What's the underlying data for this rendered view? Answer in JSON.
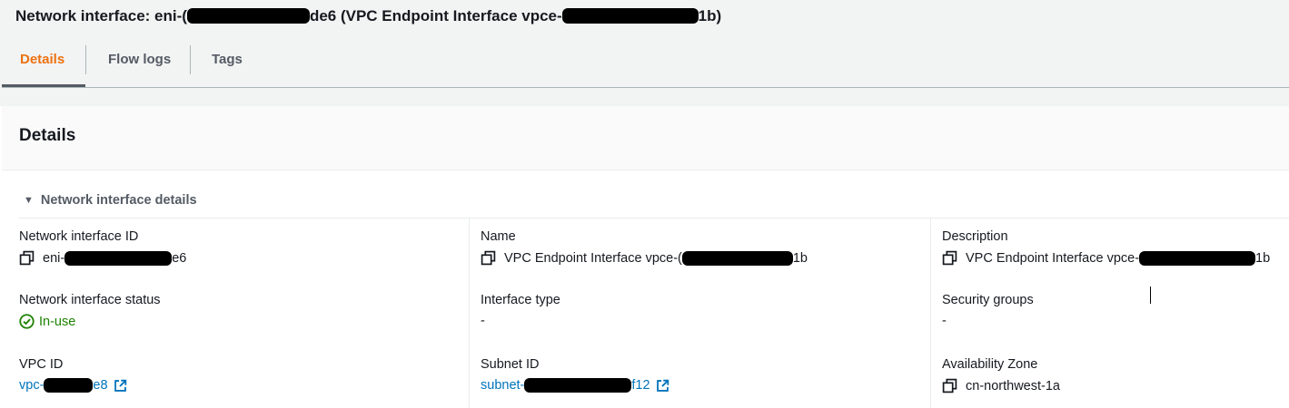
{
  "header": {
    "title_prefix": "Network interface: eni-(",
    "title_suffix": "de6 (VPC Endpoint Interface vpce-",
    "title_end": "1b)"
  },
  "tabs": [
    {
      "label": "Details",
      "active": true
    },
    {
      "label": "Flow logs",
      "active": false
    },
    {
      "label": "Tags",
      "active": false
    }
  ],
  "container": {
    "title": "Details",
    "section": "Network interface details"
  },
  "fields": {
    "network_interface_id": {
      "label": "Network interface ID",
      "value_prefix": "eni-",
      "value_suffix": "e6"
    },
    "name": {
      "label": "Name",
      "value_prefix": "VPC Endpoint Interface vpce-(",
      "value_suffix": "1b"
    },
    "description": {
      "label": "Description",
      "value_prefix": "VPC Endpoint Interface vpce-",
      "value_suffix": "1b"
    },
    "status": {
      "label": "Network interface status",
      "value": "In-use"
    },
    "interface_type": {
      "label": "Interface type",
      "value": "-"
    },
    "security_groups": {
      "label": "Security groups",
      "value": "-"
    },
    "vpc_id": {
      "label": "VPC ID",
      "value_prefix": "vpc-",
      "value_suffix": "e8"
    },
    "subnet_id": {
      "label": "Subnet ID",
      "value_prefix": "subnet-",
      "value_suffix": "f12"
    },
    "availability_zone": {
      "label": "Availability Zone",
      "value": "cn-northwest-1a"
    }
  },
  "colors": {
    "active_tab": "#ec7211",
    "link": "#0073bb",
    "success": "#1d8102",
    "header_bg": "#f2f3f3"
  },
  "icons": [
    "copy-icon",
    "external-link-icon",
    "status-ok-icon",
    "caret-down-icon"
  ]
}
